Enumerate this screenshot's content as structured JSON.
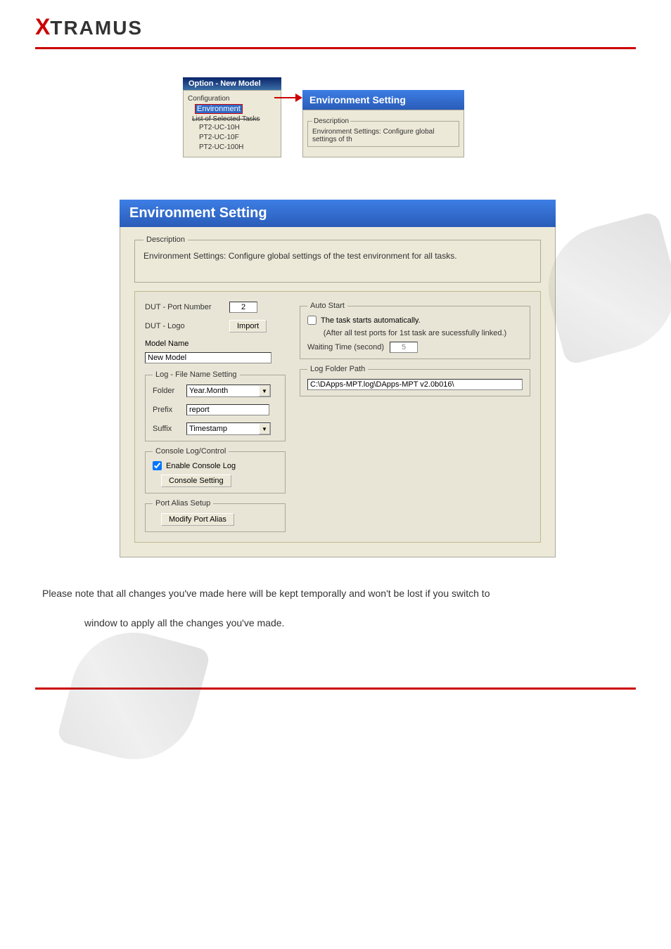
{
  "logo": {
    "x": "X",
    "rest": "TRAMUS"
  },
  "small_window": {
    "title": "Option - New Model",
    "tree_root": "Configuration",
    "selected": "Environment",
    "list_label": "List of Selected Tasks",
    "tasks": [
      "PT2-UC-10H",
      "PT2-UC-10F",
      "PT2-UC-100H"
    ]
  },
  "small_right": {
    "header": "Environment Setting",
    "desc_legend": "Description",
    "desc_text": "Environment Settings: Configure global settings of th"
  },
  "main": {
    "header": "Environment Setting",
    "desc_legend": "Description",
    "desc_text": "Environment Settings: Configure global settings of the test environment for all tasks.",
    "dut_port_label": "DUT - Port Number",
    "dut_port_value": "2",
    "dut_logo_label": "DUT - Logo",
    "import_btn": "Import",
    "model_name_label": "Model Name",
    "model_name_value": "New Model",
    "log_file_legend": "Log - File Name Setting",
    "folder_label": "Folder",
    "folder_value": "Year.Month",
    "prefix_label": "Prefix",
    "prefix_value": "report",
    "suffix_label": "Suffix",
    "suffix_value": "Timestamp",
    "console_legend": "Console Log/Control",
    "enable_console_label": "Enable Console Log",
    "console_setting_btn": "Console Setting",
    "port_alias_legend": "Port Alias Setup",
    "port_alias_btn": "Modify Port Alias",
    "auto_start_legend": "Auto Start",
    "auto_start_label": "The task starts automatically.",
    "auto_start_hint": "(After all test ports for 1st task are sucessfully linked.)",
    "waiting_label": "Waiting Time (second)",
    "waiting_value": "5",
    "log_folder_legend": "Log Folder Path",
    "log_folder_value": "C:\\DApps-MPT.log\\DApps-MPT v2.0b016\\"
  },
  "body_text_1": "Please note that all changes you've made here will be kept temporally and won't be lost if you switch to",
  "body_text_2": "window to apply all the changes you've made."
}
